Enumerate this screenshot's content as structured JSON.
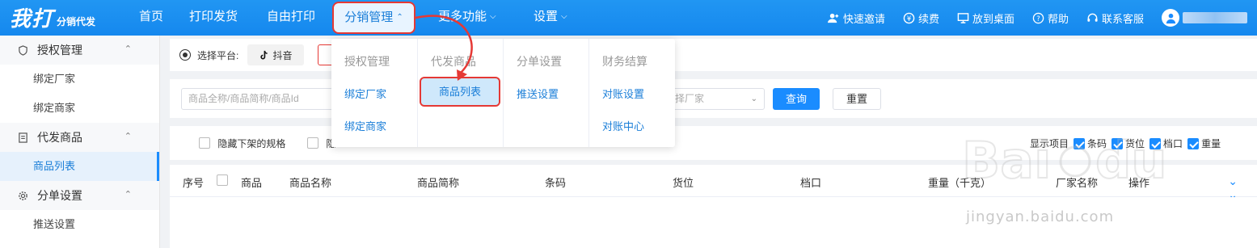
{
  "brand": {
    "logo": "我打",
    "sub": "分销代发"
  },
  "nav": {
    "items": [
      {
        "label": "首页"
      },
      {
        "label": "打印发货"
      },
      {
        "label": "自由打印"
      },
      {
        "label": "分销管理"
      },
      {
        "label": "更多功能"
      },
      {
        "label": "设置"
      }
    ]
  },
  "tools": {
    "invite": "快速邀请",
    "renew": "续费",
    "desktop": "放到桌面",
    "help": "帮助",
    "service": "联系客服"
  },
  "sidebar": {
    "groups": [
      {
        "label": "授权管理",
        "items": [
          "绑定厂家",
          "绑定商家"
        ]
      },
      {
        "label": "代发商品",
        "items": [
          "商品列表"
        ]
      },
      {
        "label": "分单设置",
        "items": [
          "推送设置"
        ]
      }
    ]
  },
  "platform": {
    "label": "选择平台:",
    "selected": "抖音"
  },
  "search": {
    "placeholder": "商品全称/商品简称/商品Id",
    "vendor_placeholder": "择厂家",
    "query": "查询",
    "reset": "重置"
  },
  "filters": {
    "hide_spec": "隐藏下架的规格",
    "hide_2": "隐",
    "show_cols_label": "显示项目",
    "options": [
      "条码",
      "货位",
      "档口",
      "重量"
    ]
  },
  "table": {
    "columns": [
      "序号",
      "商品",
      "商品名称",
      "商品简称",
      "条码",
      "货位",
      "档口",
      "重量（千克）",
      "厂家名称",
      "操作"
    ]
  },
  "dropdown": {
    "columns": [
      {
        "head": "授权管理",
        "links": [
          "绑定厂家",
          "绑定商家"
        ]
      },
      {
        "head": "代发商品",
        "links": [
          "商品列表"
        ]
      },
      {
        "head": "分单设置",
        "links": [
          "推送设置"
        ]
      },
      {
        "head": "财务结算",
        "links": [
          "对账设置",
          "对账中心"
        ]
      }
    ]
  },
  "watermark": {
    "text": "jingyan.baidu.com"
  }
}
